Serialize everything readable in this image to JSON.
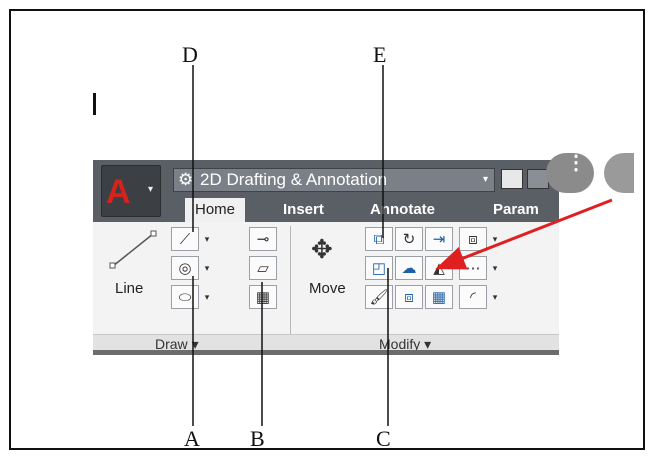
{
  "callouts": {
    "d": "D",
    "e": "E",
    "a": "A",
    "b": "B",
    "c": "C"
  },
  "workspace": {
    "name": "2D Drafting & Annotation"
  },
  "tabs": [
    "Home",
    "Insert",
    "Annotate",
    "Param"
  ],
  "draw_panel": {
    "line_label": "Line",
    "title": "Draw",
    "title_caret": "▾"
  },
  "modify_panel": {
    "move_label": "Move",
    "title": "Modify",
    "title_caret": "▾"
  },
  "glyphs": {
    "gear": "⚙",
    "caret_down": "▾",
    "app_logo": "A",
    "more_dots": "⋮"
  },
  "colors": {
    "app_logo": "#d4231a",
    "ribbon_top": "#5a5f66",
    "arrow": "#e02020",
    "panel_bg": "#f3f3f3"
  }
}
